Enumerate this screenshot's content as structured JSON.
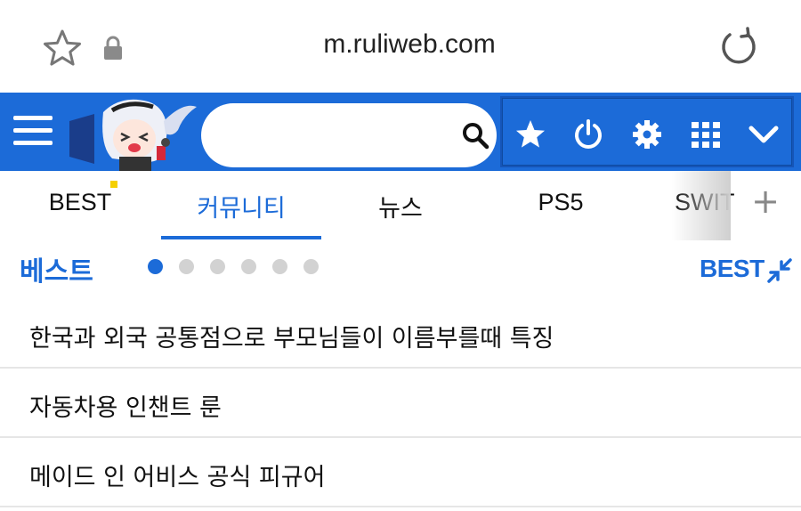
{
  "browser": {
    "url": "m.ruliweb.com",
    "icons": [
      "star-icon",
      "lock-icon",
      "reload-icon"
    ]
  },
  "header": {
    "search_value": "",
    "icons": [
      "menu-icon",
      "mascot-logo",
      "search-icon",
      "star-icon",
      "power-icon",
      "gear-icon",
      "grid-icon",
      "chevron-down-icon"
    ],
    "accent_color": "#1c6bd8"
  },
  "tabs": [
    {
      "label": "BEST",
      "active": false,
      "new": true
    },
    {
      "label": "커뮤니티",
      "active": true
    },
    {
      "label": "뉴스",
      "active": false
    },
    {
      "label": "PS5",
      "active": false
    },
    {
      "label": "SWIT",
      "active": false
    }
  ],
  "best": {
    "title": "베스트",
    "pages": 6,
    "current_page": 1,
    "link_label": "BEST",
    "items": [
      "한국과 외국 공통점으로 부모님들이 이름부를때 특징",
      "자동차용 인챈트 룬",
      "메이드 인 어비스 공식 피규어"
    ]
  }
}
